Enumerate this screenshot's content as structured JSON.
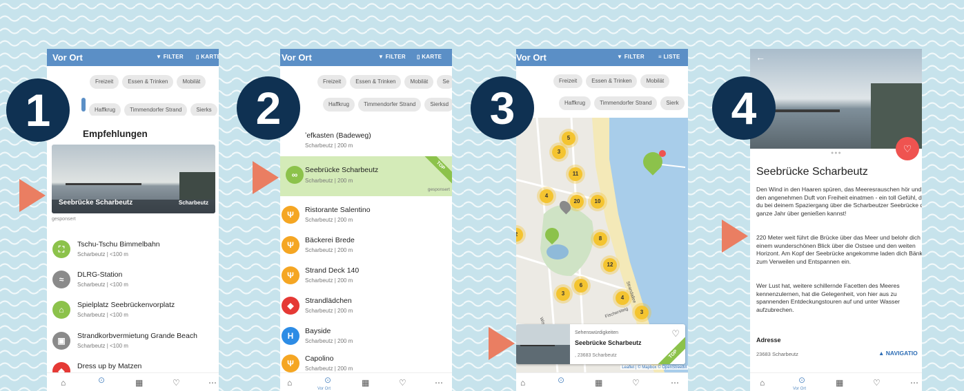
{
  "colors": {
    "appbar": "#5b8fc6",
    "badge": "#0f3152",
    "arrow": "#ea7e62",
    "top_ribbon": "#8cc24b",
    "heart": "#ef5350"
  },
  "steps": [
    "1",
    "2",
    "3",
    "4"
  ],
  "appbar": {
    "title": "Vor Ort",
    "filter": "FILTER",
    "map": "KARTE",
    "list": "LISTE"
  },
  "screen1": {
    "categories": [
      "Freizeit",
      "Essen & Trinken",
      "Mobilät"
    ],
    "locations": [
      "Haffkrug",
      "Timmendorfer Strand",
      "Sierks"
    ],
    "section_title": "Empfehlungen",
    "hero": {
      "title": "Seebrücke Scharbeutz",
      "place": "Scharbeutz",
      "sponsored": "gesponsert"
    },
    "items": [
      {
        "name": "Tschu-Tschu Bimmelbahn",
        "sub": "Scharbeutz | <100 m",
        "icon": "ticket-icon",
        "color": "#8cc24b"
      },
      {
        "name": "DLRG-Station",
        "sub": "Scharbeutz | <100 m",
        "icon": "lifeguard-icon",
        "color": "#8a8a8a"
      },
      {
        "name": "Spielplatz Seebrückenvorplatz",
        "sub": "Scharbeutz | <100 m",
        "icon": "playground-icon",
        "color": "#8cc24b"
      },
      {
        "name": "Strandkorbvermietung Grande Beach",
        "sub": "Scharbeutz | <100 m",
        "icon": "beach-chair-icon",
        "color": "#8a8a8a"
      },
      {
        "name": "Dress up by Matzen",
        "sub": "",
        "icon": "shopping-icon",
        "color": "#e53935"
      }
    ]
  },
  "screen2": {
    "categories": [
      "Freizeit",
      "Essen & Trinken",
      "Mobilät",
      "Se"
    ],
    "locations": [
      "Haffkrug",
      "Timmendorfer Strand",
      "Sierksd"
    ],
    "items": [
      {
        "name": "ʼefkasten (Badeweg)",
        "sub": "Scharbeutz | 200 m",
        "icon": "",
        "color": ""
      },
      {
        "name": "Seebrücke Scharbeutz",
        "sub": "Scharbeutz | 200 m",
        "icon": "binoculars-icon",
        "color": "#8cc24b"
      },
      {
        "name": "Ristorante Salentino",
        "sub": "Scharbeutz | 200 m",
        "icon": "restaurant-icon",
        "color": "#f5a623"
      },
      {
        "name": "Bäckerei Brede",
        "sub": "Scharbeutz | 200 m",
        "icon": "restaurant-icon",
        "color": "#f5a623"
      },
      {
        "name": "Strand Deck 140",
        "sub": "Scharbeutz | 200 m",
        "icon": "restaurant-icon",
        "color": "#f5a623"
      },
      {
        "name": "Strandlädchen",
        "sub": "Scharbeutz | 200 m",
        "icon": "shopping-icon",
        "color": "#e53935"
      },
      {
        "name": "Bayside",
        "sub": "Scharbeutz | 200 m",
        "icon": "hotel-icon",
        "color": "#2d8ce5"
      },
      {
        "name": "Capolino",
        "sub": "Scharbeutz | 200 m",
        "icon": "restaurant-icon",
        "color": "#f5a623"
      }
    ],
    "top": "TOP",
    "sponsored": "gesponsert"
  },
  "screen3": {
    "categories": [
      "Freizeit",
      "Essen & Trinken",
      "Mobilät"
    ],
    "locations": [
      "Haffkrug",
      "Timmendorfer Strand",
      "Sierk"
    ],
    "clusters": [
      "5",
      "3",
      "11",
      "4",
      "20",
      "10",
      "8",
      "12",
      "6",
      "3",
      "4",
      "3",
      "2"
    ],
    "streets": [
      "Strandallee",
      "Fischersteig",
      "Wisch"
    ],
    "card": {
      "category": "Sehenswürdigkeiten",
      "title": "Seebrücke Scharbeutz",
      "address": ", 23683 Scharbeutz",
      "top": "TOP"
    },
    "attribution": "Leaflet | © Mapbox © OpenStreetM"
  },
  "screen4": {
    "title": "Seebrücke Scharbeutz",
    "text1": "Den Wind in den Haaren spüren, das Meeresrauschen hör und den angenehmen Duft von Freiheit einatmen - ein toll Gefühl, das du bei deinem Spaziergang über die Scharbeutzer Seebrücke das ganze Jahr über genießen kannst!",
    "text2": "220 Meter weit führt die Brücke über das Meer und belohr dich mit einem wunderschönen Blick über die Ostsee und den weiten Horizont. Am Kopf der Seebrücke angekomme laden dich Bänke zum Verweilen und Entspannen ein.",
    "text3": "Wer Lust hat, weitere schillernde Facetten des Meeres kennenzulernen, hat die Gelegenheit, von hier aus zu spannenden Entdeckungstouren auf und unter Wasser aufzubrechen.",
    "address_label": "Adresse",
    "address": "23683 Scharbeutz",
    "navigation": "NAVIGATIO"
  },
  "nav": {
    "vor_ort": "Vor Ort"
  }
}
